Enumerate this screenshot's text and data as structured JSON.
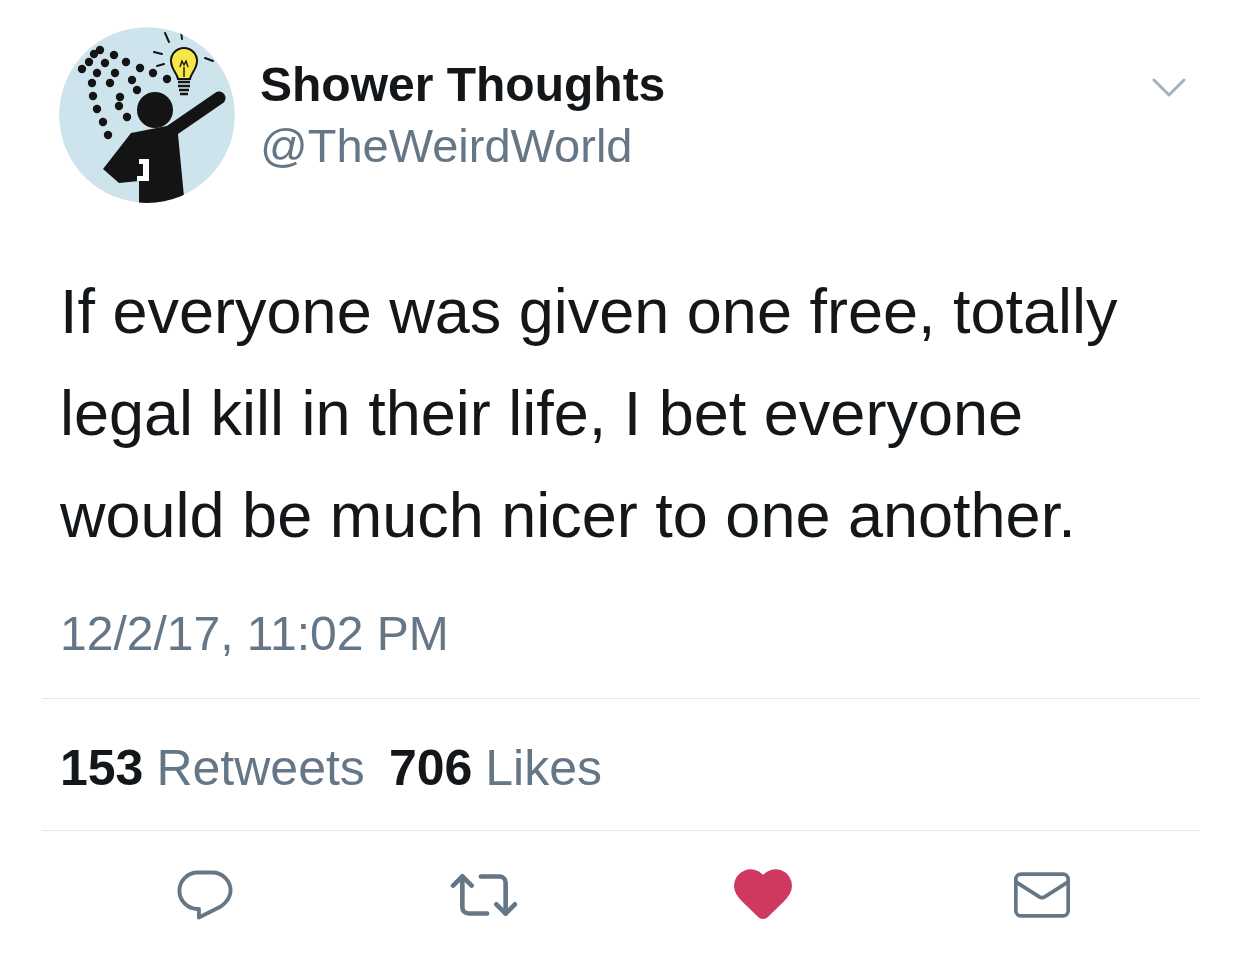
{
  "account": {
    "name": "Shower Thoughts",
    "handle": "@TheWeirdWorld"
  },
  "tweet": {
    "text": "If everyone was given one free, totally legal kill in their life, I bet everyone would be much nicer to one another.",
    "timestamp": "12/2/17, 11:02 PM"
  },
  "stats": [
    {
      "count": "153",
      "label": "Retweets"
    },
    {
      "count": "706",
      "label": "Likes"
    }
  ],
  "actions": [
    {
      "kind": "reply",
      "active": false
    },
    {
      "kind": "retweet",
      "active": false
    },
    {
      "kind": "like",
      "active": true
    },
    {
      "kind": "message",
      "active": false
    }
  ]
}
